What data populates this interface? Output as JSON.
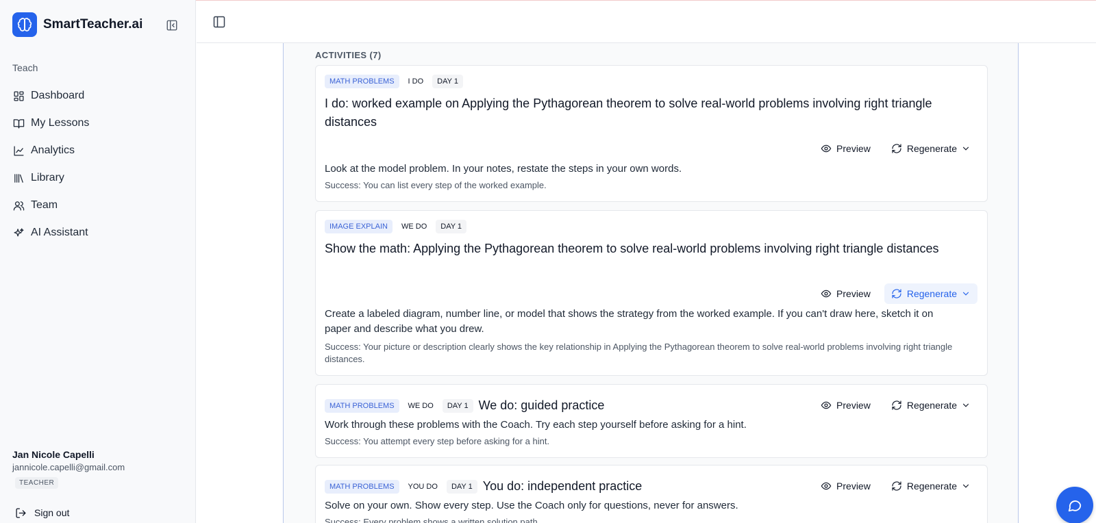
{
  "app": {
    "name": "SmartTeacher.ai"
  },
  "sidebar": {
    "section_label": "Teach",
    "items": [
      {
        "label": "Dashboard",
        "icon": "dashboard-icon"
      },
      {
        "label": "My Lessons",
        "icon": "book-icon"
      },
      {
        "label": "Analytics",
        "icon": "chart-line-icon"
      },
      {
        "label": "Library",
        "icon": "library-icon"
      },
      {
        "label": "Team",
        "icon": "users-icon"
      },
      {
        "label": "AI Assistant",
        "icon": "sparkles-icon"
      }
    ],
    "user": {
      "name": "Jan Nicole Capelli",
      "email": "jannicole.capelli@gmail.com",
      "role": "TEACHER"
    },
    "sign_out": "Sign out"
  },
  "activities": {
    "title": "ACTIVITIES (7)",
    "preview_label": "Preview",
    "regenerate_label": "Regenerate",
    "items": [
      {
        "type": "MATH PROBLEMS",
        "mode": "I DO",
        "day": "DAY 1",
        "title": "I do: worked example on Applying the Pythagorean theorem to solve real-world problems involving right triangle distances",
        "description": "Look at the model problem. In your notes, restate the steps in your own words.",
        "success": "Success: You can list every step of the worked example."
      },
      {
        "type": "IMAGE EXPLAIN",
        "mode": "WE DO",
        "day": "DAY 1",
        "title": "Show the math: Applying the Pythagorean theorem to solve real-world problems involving right triangle distances",
        "description": "Create a labeled diagram, number line, or model that shows the strategy from the worked example. If you can't draw here, sketch it on paper and describe what you drew.",
        "success": "Success: Your picture or description clearly shows the key relationship in Applying the Pythagorean theorem to solve real-world problems involving right triangle distances."
      },
      {
        "type": "MATH PROBLEMS",
        "mode": "WE DO",
        "day": "DAY 1",
        "title": "We do: guided practice",
        "description": "Work through these problems with the Coach. Try each step yourself before asking for a hint.",
        "success": "Success: You attempt every step before asking for a hint."
      },
      {
        "type": "MATH PROBLEMS",
        "mode": "YOU DO",
        "day": "DAY 1",
        "title": "You do: independent practice",
        "description": "Solve on your own. Show every step. Use the Coach only for questions, never for answers.",
        "success": "Success: Every problem shows a written solution path."
      }
    ]
  },
  "colors": {
    "accent": "#2563eb",
    "tag_type_bg": "#e8eefc",
    "tag_type_text": "#3b63d6"
  }
}
